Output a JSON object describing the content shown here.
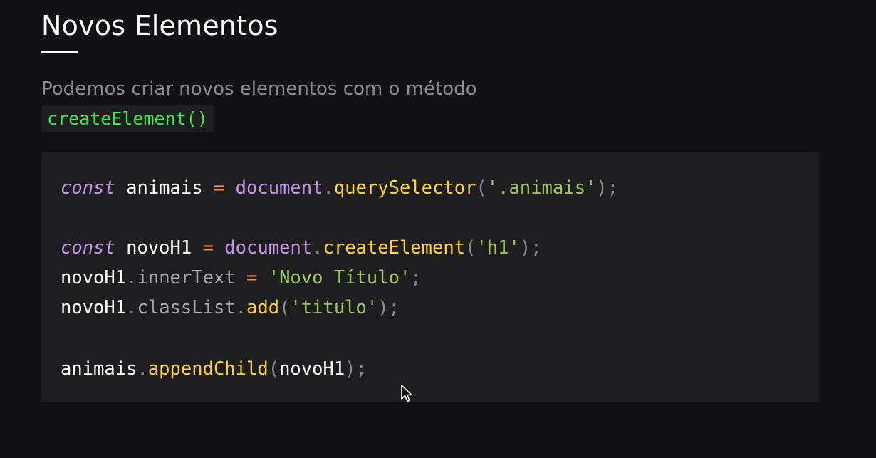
{
  "section": {
    "title": "Novos Elementos",
    "lead": "Podemos criar novos elementos com o método",
    "inline_code": "createElement()"
  },
  "code": {
    "lines": [
      [
        {
          "t": "kw",
          "v": "const"
        },
        {
          "t": "id",
          "v": " animais "
        },
        {
          "t": "op",
          "v": "="
        },
        {
          "t": "obj",
          "v": " document"
        },
        {
          "t": "punct",
          "v": "."
        },
        {
          "t": "fn",
          "v": "querySelector"
        },
        {
          "t": "punct",
          "v": "("
        },
        {
          "t": "str",
          "v": "'.animais'"
        },
        {
          "t": "punct",
          "v": ");"
        }
      ],
      [],
      [
        {
          "t": "kw",
          "v": "const"
        },
        {
          "t": "id",
          "v": " novoH1 "
        },
        {
          "t": "op",
          "v": "="
        },
        {
          "t": "obj",
          "v": " document"
        },
        {
          "t": "punct",
          "v": "."
        },
        {
          "t": "fn",
          "v": "createElement"
        },
        {
          "t": "punct",
          "v": "("
        },
        {
          "t": "str",
          "v": "'h1'"
        },
        {
          "t": "punct",
          "v": ");"
        }
      ],
      [
        {
          "t": "id",
          "v": "novoH1"
        },
        {
          "t": "punct",
          "v": "."
        },
        {
          "t": "prop",
          "v": "innerText"
        },
        {
          "t": "op",
          "v": " = "
        },
        {
          "t": "str",
          "v": "'Novo Título'"
        },
        {
          "t": "punct",
          "v": ";"
        }
      ],
      [
        {
          "t": "id",
          "v": "novoH1"
        },
        {
          "t": "punct",
          "v": "."
        },
        {
          "t": "prop",
          "v": "classList"
        },
        {
          "t": "punct",
          "v": "."
        },
        {
          "t": "fn",
          "v": "add"
        },
        {
          "t": "punct",
          "v": "("
        },
        {
          "t": "str",
          "v": "'titulo'"
        },
        {
          "t": "punct",
          "v": ");"
        }
      ],
      [],
      [
        {
          "t": "id",
          "v": "animais"
        },
        {
          "t": "punct",
          "v": "."
        },
        {
          "t": "fn",
          "v": "appendChild"
        },
        {
          "t": "punct",
          "v": "("
        },
        {
          "t": "id",
          "v": "novoH1"
        },
        {
          "t": "punct",
          "v": ");"
        }
      ]
    ]
  },
  "colors": {
    "background": "#111116",
    "inline_code_green": "#3be84a",
    "keyword": "#c792ea",
    "function": "#ffd13a",
    "string": "#9cc95a",
    "operator": "#f78c4e"
  },
  "icons": {
    "cursor": "mouse-pointer-icon"
  }
}
